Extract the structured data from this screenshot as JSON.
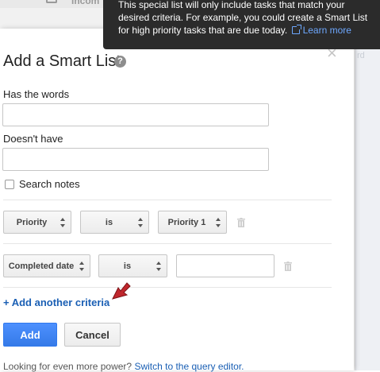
{
  "background": {
    "inbox_partial": "Incom"
  },
  "tooltip": {
    "text": "This special list will only include tasks that match your desired criteria. For example, you could create a Smart List for high priority tasks that are due today.",
    "link_label": "Learn more"
  },
  "dialog": {
    "title": "Add a Smart List",
    "help_icon_glyph": "?",
    "close_glyph": "×",
    "has_words_label": "Has the words",
    "has_words_value": "",
    "doesnt_have_label": "Doesn't have",
    "doesnt_have_value": "",
    "search_notes_label": "Search notes",
    "search_notes_checked": false,
    "criteria": [
      {
        "field": "Priority",
        "operator": "is",
        "value": "Priority 1",
        "value_type": "select"
      },
      {
        "field": "Completed date",
        "operator": "is",
        "value": "",
        "value_type": "text"
      }
    ],
    "add_criteria_label": "+ Add another criteria",
    "add_button": "Add",
    "cancel_button": "Cancel",
    "footer_text": "Looking for even more power?",
    "footer_link": "Switch to the query editor."
  },
  "colors": {
    "primary_button": "#4d90fe",
    "link": "#1a5fb4",
    "tooltip_bg": "#2b2b2b",
    "annotation_arrow": "#c0272d"
  },
  "icons": [
    "help-icon",
    "close-icon",
    "trash-icon",
    "external-link-icon",
    "select-arrows-icon",
    "red-pointer-arrow"
  ]
}
